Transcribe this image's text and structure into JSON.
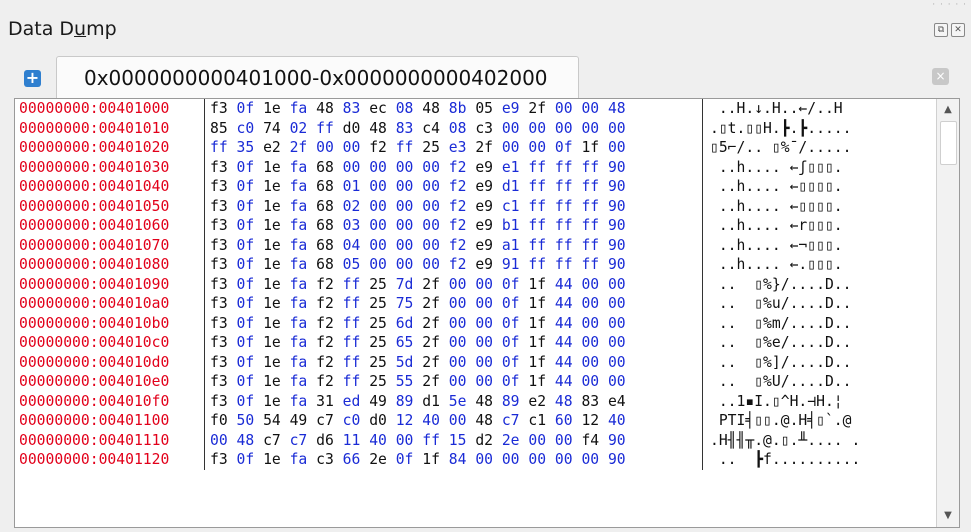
{
  "window": {
    "title_pre": "Data D",
    "title_ul": "u",
    "title_post": "mp",
    "restore_icon": "⧉",
    "close_icon": "✕"
  },
  "tab": {
    "add_icon": "+",
    "label": "0x0000000000401000-0x0000000000402000",
    "close_icon": "×"
  },
  "scrollbar": {
    "up": "▲",
    "down": "▼"
  },
  "rows": [
    {
      "addr": "00000000:00401000",
      "bytes": [
        "f3",
        "0f",
        "1e",
        "fa",
        "48",
        "83",
        "ec",
        "08",
        "48",
        "8b",
        "05",
        "e9",
        "2f",
        "00",
        "00",
        "48"
      ],
      "ascii": " ..H.↓.H..←/..H"
    },
    {
      "addr": "00000000:00401010",
      "bytes": [
        "85",
        "c0",
        "74",
        "02",
        "ff",
        "d0",
        "48",
        "83",
        "c4",
        "08",
        "c3",
        "00",
        "00",
        "00",
        "00",
        "00"
      ],
      "ascii": ".▯t.▯▯H.┣.┣....."
    },
    {
      "addr": "00000000:00401020",
      "bytes": [
        "ff",
        "35",
        "e2",
        "2f",
        "00",
        "00",
        "f2",
        "ff",
        "25",
        "e3",
        "2f",
        "00",
        "00",
        "0f",
        "1f",
        "00"
      ],
      "ascii": "▯5⌐/.. ▯%¯/....."
    },
    {
      "addr": "00000000:00401030",
      "bytes": [
        "f3",
        "0f",
        "1e",
        "fa",
        "68",
        "00",
        "00",
        "00",
        "00",
        "f2",
        "e9",
        "e1",
        "ff",
        "ff",
        "ff",
        "90"
      ],
      "ascii": " ..h.... ←ʃ▯▯▯."
    },
    {
      "addr": "00000000:00401040",
      "bytes": [
        "f3",
        "0f",
        "1e",
        "fa",
        "68",
        "01",
        "00",
        "00",
        "00",
        "f2",
        "e9",
        "d1",
        "ff",
        "ff",
        "ff",
        "90"
      ],
      "ascii": " ..h.... ←▯▯▯▯."
    },
    {
      "addr": "00000000:00401050",
      "bytes": [
        "f3",
        "0f",
        "1e",
        "fa",
        "68",
        "02",
        "00",
        "00",
        "00",
        "f2",
        "e9",
        "c1",
        "ff",
        "ff",
        "ff",
        "90"
      ],
      "ascii": " ..h.... ←▯▯▯▯."
    },
    {
      "addr": "00000000:00401060",
      "bytes": [
        "f3",
        "0f",
        "1e",
        "fa",
        "68",
        "03",
        "00",
        "00",
        "00",
        "f2",
        "e9",
        "b1",
        "ff",
        "ff",
        "ff",
        "90"
      ],
      "ascii": " ..h.... ←r▯▯▯."
    },
    {
      "addr": "00000000:00401070",
      "bytes": [
        "f3",
        "0f",
        "1e",
        "fa",
        "68",
        "04",
        "00",
        "00",
        "00",
        "f2",
        "e9",
        "a1",
        "ff",
        "ff",
        "ff",
        "90"
      ],
      "ascii": " ..h.... ←¬▯▯▯."
    },
    {
      "addr": "00000000:00401080",
      "bytes": [
        "f3",
        "0f",
        "1e",
        "fa",
        "68",
        "05",
        "00",
        "00",
        "00",
        "f2",
        "e9",
        "91",
        "ff",
        "ff",
        "ff",
        "90"
      ],
      "ascii": " ..h.... ←.▯▯▯."
    },
    {
      "addr": "00000000:00401090",
      "bytes": [
        "f3",
        "0f",
        "1e",
        "fa",
        "f2",
        "ff",
        "25",
        "7d",
        "2f",
        "00",
        "00",
        "0f",
        "1f",
        "44",
        "00",
        "00"
      ],
      "ascii": " ..  ▯%}/....D.."
    },
    {
      "addr": "00000000:004010a0",
      "bytes": [
        "f3",
        "0f",
        "1e",
        "fa",
        "f2",
        "ff",
        "25",
        "75",
        "2f",
        "00",
        "00",
        "0f",
        "1f",
        "44",
        "00",
        "00"
      ],
      "ascii": " ..  ▯%u/....D.."
    },
    {
      "addr": "00000000:004010b0",
      "bytes": [
        "f3",
        "0f",
        "1e",
        "fa",
        "f2",
        "ff",
        "25",
        "6d",
        "2f",
        "00",
        "00",
        "0f",
        "1f",
        "44",
        "00",
        "00"
      ],
      "ascii": " ..  ▯%m/....D.."
    },
    {
      "addr": "00000000:004010c0",
      "bytes": [
        "f3",
        "0f",
        "1e",
        "fa",
        "f2",
        "ff",
        "25",
        "65",
        "2f",
        "00",
        "00",
        "0f",
        "1f",
        "44",
        "00",
        "00"
      ],
      "ascii": " ..  ▯%e/....D.."
    },
    {
      "addr": "00000000:004010d0",
      "bytes": [
        "f3",
        "0f",
        "1e",
        "fa",
        "f2",
        "ff",
        "25",
        "5d",
        "2f",
        "00",
        "00",
        "0f",
        "1f",
        "44",
        "00",
        "00"
      ],
      "ascii": " ..  ▯%]/....D.."
    },
    {
      "addr": "00000000:004010e0",
      "bytes": [
        "f3",
        "0f",
        "1e",
        "fa",
        "f2",
        "ff",
        "25",
        "55",
        "2f",
        "00",
        "00",
        "0f",
        "1f",
        "44",
        "00",
        "00"
      ],
      "ascii": " ..  ▯%U/....D.."
    },
    {
      "addr": "00000000:004010f0",
      "bytes": [
        "f3",
        "0f",
        "1e",
        "fa",
        "31",
        "ed",
        "49",
        "89",
        "d1",
        "5e",
        "48",
        "89",
        "e2",
        "48",
        "83",
        "e4"
      ],
      "ascii": " ..1▪I.▯^H.⊣H.¦"
    },
    {
      "addr": "00000000:00401100",
      "bytes": [
        "f0",
        "50",
        "54",
        "49",
        "c7",
        "c0",
        "d0",
        "12",
        "40",
        "00",
        "48",
        "c7",
        "c1",
        "60",
        "12",
        "40"
      ],
      "ascii": " PTI╡▯▯.@.H╡▯`.@"
    },
    {
      "addr": "00000000:00401110",
      "bytes": [
        "00",
        "48",
        "c7",
        "c7",
        "d6",
        "11",
        "40",
        "00",
        "ff",
        "15",
        "d2",
        "2e",
        "00",
        "00",
        "f4",
        "90"
      ],
      "ascii": ".H╢╢╥.@.▯.╨.... ."
    },
    {
      "addr": "00000000:00401120",
      "bytes": [
        "f3",
        "0f",
        "1e",
        "fa",
        "c3",
        "66",
        "2e",
        "0f",
        "1f",
        "84",
        "00",
        "00",
        "00",
        "00",
        "00",
        "90"
      ],
      "ascii": " ..  ┣f.........."
    }
  ]
}
